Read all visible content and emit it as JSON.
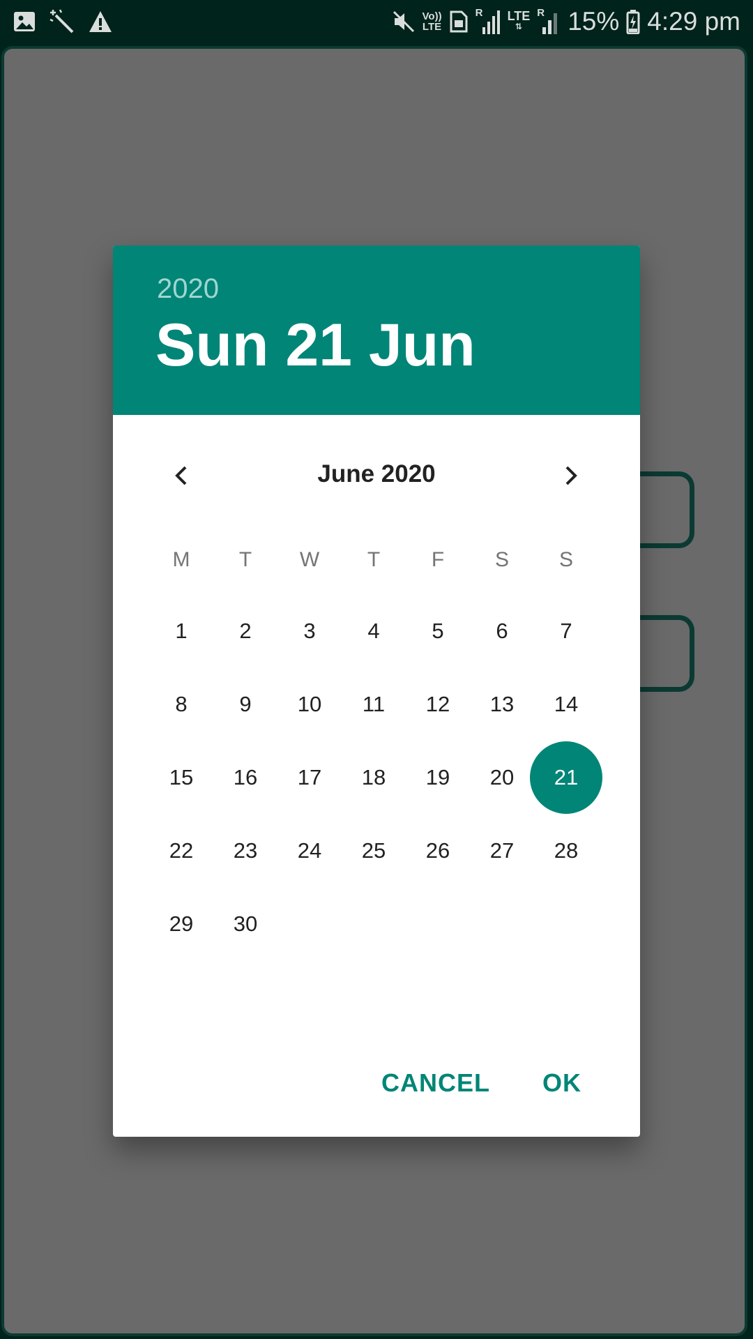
{
  "status_bar": {
    "network_top": "Vo))",
    "network_bottom": "LTE",
    "roaming_1": "R",
    "lte_2": "LTE",
    "roaming_2": "R",
    "battery_percent": "15%",
    "time": "4:29 pm"
  },
  "dialog": {
    "header": {
      "year": "2020",
      "date": "Sun 21 Jun"
    },
    "month_label": "June 2020",
    "weekdays": [
      "M",
      "T",
      "W",
      "T",
      "F",
      "S",
      "S"
    ],
    "days": [
      {
        "n": "1",
        "c": 0,
        "r": 0
      },
      {
        "n": "2",
        "c": 1,
        "r": 0
      },
      {
        "n": "3",
        "c": 2,
        "r": 0
      },
      {
        "n": "4",
        "c": 3,
        "r": 0
      },
      {
        "n": "5",
        "c": 4,
        "r": 0
      },
      {
        "n": "6",
        "c": 5,
        "r": 0
      },
      {
        "n": "7",
        "c": 6,
        "r": 0
      },
      {
        "n": "8",
        "c": 0,
        "r": 1
      },
      {
        "n": "9",
        "c": 1,
        "r": 1
      },
      {
        "n": "10",
        "c": 2,
        "r": 1
      },
      {
        "n": "11",
        "c": 3,
        "r": 1
      },
      {
        "n": "12",
        "c": 4,
        "r": 1
      },
      {
        "n": "13",
        "c": 5,
        "r": 1
      },
      {
        "n": "14",
        "c": 6,
        "r": 1
      },
      {
        "n": "15",
        "c": 0,
        "r": 2
      },
      {
        "n": "16",
        "c": 1,
        "r": 2
      },
      {
        "n": "17",
        "c": 2,
        "r": 2
      },
      {
        "n": "18",
        "c": 3,
        "r": 2
      },
      {
        "n": "19",
        "c": 4,
        "r": 2
      },
      {
        "n": "20",
        "c": 5,
        "r": 2
      },
      {
        "n": "21",
        "c": 6,
        "r": 2
      },
      {
        "n": "22",
        "c": 0,
        "r": 3
      },
      {
        "n": "23",
        "c": 1,
        "r": 3
      },
      {
        "n": "24",
        "c": 2,
        "r": 3
      },
      {
        "n": "25",
        "c": 3,
        "r": 3
      },
      {
        "n": "26",
        "c": 4,
        "r": 3
      },
      {
        "n": "27",
        "c": 5,
        "r": 3
      },
      {
        "n": "28",
        "c": 6,
        "r": 3
      },
      {
        "n": "29",
        "c": 0,
        "r": 4
      },
      {
        "n": "30",
        "c": 1,
        "r": 4
      }
    ],
    "selected_day": "21",
    "cancel_label": "CANCEL",
    "ok_label": "OK",
    "accent_color": "#008577"
  }
}
